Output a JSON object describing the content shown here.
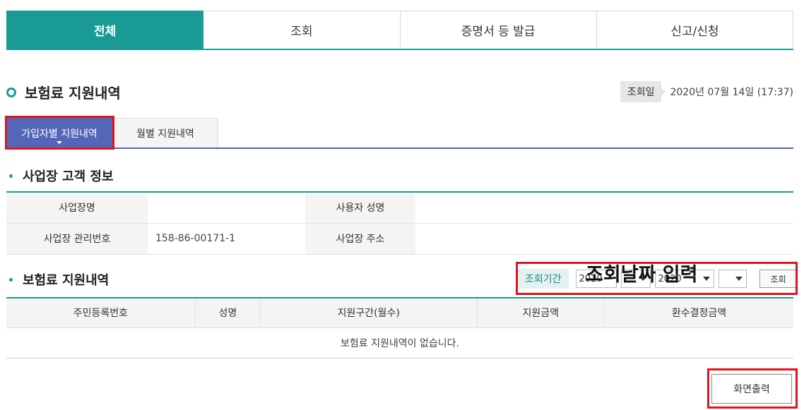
{
  "top_tabs": [
    {
      "label": "전체",
      "active": true
    },
    {
      "label": "조회",
      "active": false
    },
    {
      "label": "증명서 등 발급",
      "active": false
    },
    {
      "label": "신고/신청",
      "active": false
    }
  ],
  "page": {
    "title": "보험료 지원내역",
    "query_date_label": "조회일",
    "query_date_value": "2020년 07월 14일 (17:37)"
  },
  "sub_tabs": [
    {
      "label": "가입자별 지원내역",
      "active": true
    },
    {
      "label": "월별 지원내역",
      "active": false
    }
  ],
  "business_section": {
    "heading": "사업장 고객 정보",
    "rows": [
      {
        "label1": "사업장명",
        "value1": "",
        "label2": "사용자 성명",
        "value2": ""
      },
      {
        "label1": "사업장 관리번호",
        "value1": "158-86-00171-1",
        "label2": "사업장 주소",
        "value2": ""
      }
    ]
  },
  "support_section": {
    "heading": "보험료 지원내역",
    "period_label": "조회기간",
    "from_year": "2020",
    "from_month": "",
    "to_year": "2020",
    "to_month": "",
    "query_button": "조회",
    "overlay_note": "조회날짜 입력",
    "columns": [
      "주민등록번호",
      "성명",
      "지원구간(월수)",
      "지원금액",
      "환수결정금액"
    ],
    "empty_message": "보험료 지원내역이 없습니다."
  },
  "print_button": "화면출력",
  "colors": {
    "teal": "#1a9a94",
    "indigo": "#5566b8",
    "highlight_red": "#e0141e"
  }
}
